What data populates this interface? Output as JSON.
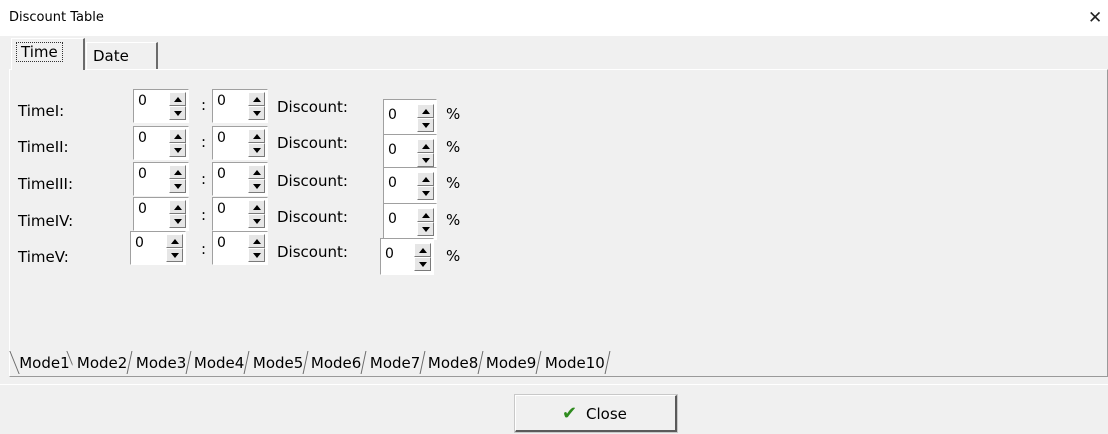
{
  "window": {
    "title": "Discount Table",
    "close_glyph": "✕"
  },
  "top_tabs": [
    {
      "label": "Time",
      "active": true
    },
    {
      "label": "Date",
      "active": false
    }
  ],
  "rows": [
    {
      "label": "TimeI:",
      "hour": "0",
      "minute": "0",
      "discount_label": "Discount:",
      "discount": "0",
      "unit": "%"
    },
    {
      "label": "TimeII:",
      "hour": "0",
      "minute": "0",
      "discount_label": "Discount:",
      "discount": "0",
      "unit": "%"
    },
    {
      "label": "TimeIII:",
      "hour": "0",
      "minute": "0",
      "discount_label": "Discount:",
      "discount": "0",
      "unit": "%"
    },
    {
      "label": "TimeIV:",
      "hour": "0",
      "minute": "0",
      "discount_label": "Discount:",
      "discount": "0",
      "unit": "%"
    },
    {
      "label": "TimeV:",
      "hour": "0",
      "minute": "0",
      "discount_label": "Discount:",
      "discount": "0",
      "unit": "%"
    }
  ],
  "separator": ":",
  "mode_tabs": [
    "Mode1",
    "Mode2",
    "Mode3",
    "Mode4",
    "Mode5",
    "Mode6",
    "Mode7",
    "Mode8",
    "Mode9",
    "Mode10"
  ],
  "footer": {
    "close_label": "Close",
    "close_icon": "check-icon"
  },
  "colors": {
    "background": "#f0f0f0",
    "check": "#2e8b1e"
  }
}
